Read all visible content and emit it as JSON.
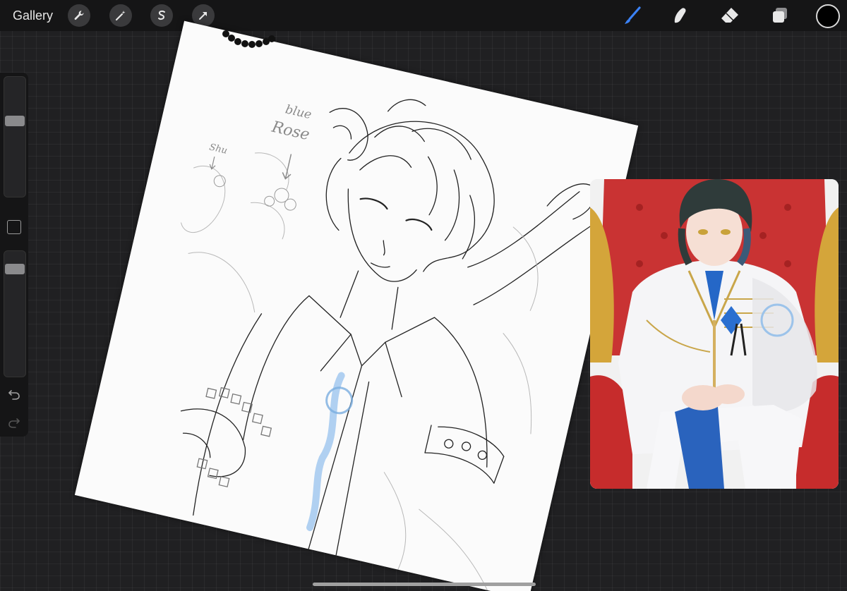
{
  "topbar": {
    "gallery_label": "Gallery",
    "actions": [
      {
        "name": "wrench-icon"
      },
      {
        "name": "magic-wand-icon"
      },
      {
        "name": "selection-s-icon"
      },
      {
        "name": "transform-arrow-icon"
      }
    ],
    "tools": [
      {
        "name": "brush-icon",
        "active": true
      },
      {
        "name": "smudge-icon",
        "active": false
      },
      {
        "name": "eraser-icon",
        "active": false
      },
      {
        "name": "layers-icon",
        "active": false
      }
    ],
    "current_color": "#000000",
    "accent_color": "#3b82f6"
  },
  "sidebar": {
    "brush_size_level": 0.65,
    "opacity_level": 0.1,
    "modify_icon": "square-modify-icon",
    "undo_icon": "undo-icon",
    "redo_icon": "redo-icon"
  },
  "canvas": {
    "annotations": {
      "line1": "blue",
      "line2": "Rose",
      "line3": "Shu"
    }
  },
  "reference": {
    "icon": "reference-image"
  }
}
